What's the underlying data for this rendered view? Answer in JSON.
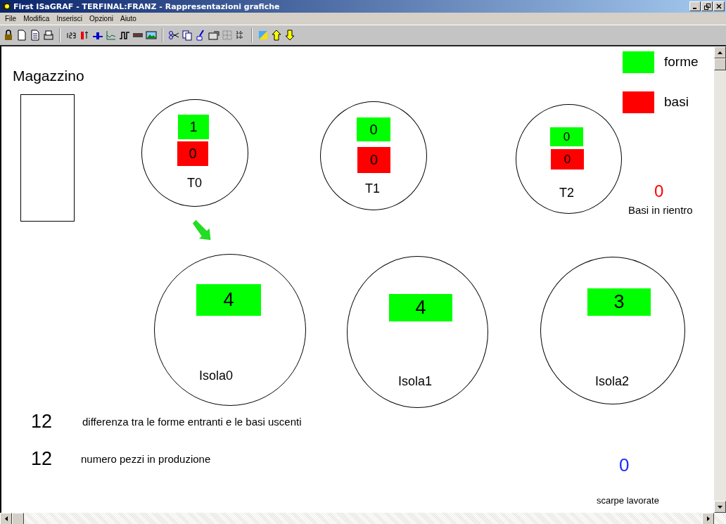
{
  "window": {
    "title": "First ISaGRAF - TERFINAL:FRANZ - Rappresentazioni grafiche"
  },
  "menu": [
    "File",
    "Modifica",
    "Inserisci",
    "Opzioni",
    "Aiuto"
  ],
  "warehouse": {
    "label": "Magazzino"
  },
  "legend": [
    {
      "label": "forme",
      "color": "#00ff00"
    },
    {
      "label": "basi",
      "color": "#ff0000"
    }
  ],
  "transfers": [
    {
      "label": "T0",
      "forme": "1",
      "basi": "0"
    },
    {
      "label": "T1",
      "forme": "0",
      "basi": "0"
    },
    {
      "label": "T2",
      "forme": "0",
      "basi": "0"
    }
  ],
  "returning_bases": {
    "value": "0",
    "label": "Basi in rientro"
  },
  "islands": [
    {
      "label": "Isola0",
      "value": "4"
    },
    {
      "label": "Isola1",
      "value": "4"
    },
    {
      "label": "Isola2",
      "value": "3"
    }
  ],
  "counters": [
    {
      "value": "12",
      "label": "differenza tra le forme entranti e le basi uscenti"
    },
    {
      "value": "12",
      "label": "numero pezzi in produzione"
    }
  ],
  "finished": {
    "value": "0",
    "label": "scarpe lavorate"
  }
}
